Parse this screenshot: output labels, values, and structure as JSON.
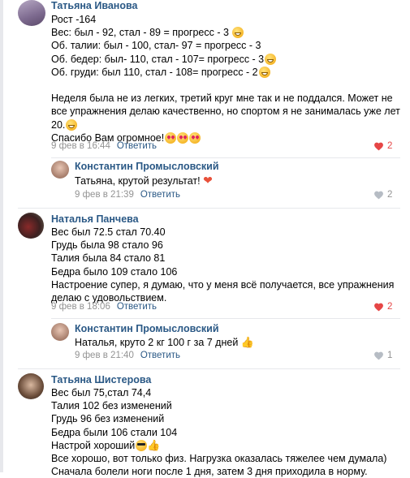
{
  "comments": [
    {
      "author": "Татьяна Иванова",
      "lines": [
        "Рост -164",
        "Вес: был - 92, стал - 89 = прогресс - 3",
        "Об. талии: был - 100, стал- 97 = прогресс - 3",
        "Об. бедер: был- 110, стал - 107= прогресс - 3",
        "Об. груди: был 110, стал - 108= прогресс - 2",
        "",
        "Неделя была не из легких, третий круг мне так и не поддался. Может не",
        "все упражнения делаю качественно, но спортом я не занималась уже лет",
        "20.",
        "Спасибо Вам огромное!"
      ],
      "time": "9 фев в 16:44",
      "reply_label": "Ответить",
      "likes": "2",
      "liked": true
    },
    {
      "author": "Константин Промысловский",
      "lines": [
        "Татьяна, крутой результат!"
      ],
      "time": "9 фев в 21:39",
      "reply_label": "Ответить",
      "likes": "2",
      "liked": false
    },
    {
      "author": "Наталья Панчева",
      "lines": [
        "Вес был 72.5 стал 70.40",
        "Грудь была 98 стало 96",
        "Талия была 84 стало 81",
        "Бедра было 109 стало 106",
        "Настроение супер, я думаю, что у меня всё получается, все упражнения",
        "делаю с удовольствием."
      ],
      "time": "9 фев в 18:06",
      "reply_label": "Ответить",
      "likes": "2",
      "liked": true
    },
    {
      "author": "Константин Промысловский",
      "lines": [
        "Наталья, круто 2 кг 100 г за 7 дней"
      ],
      "time": "9 фев в 21:40",
      "reply_label": "Ответить",
      "likes": "1",
      "liked": false
    },
    {
      "author": "Татьяна Шистерова",
      "lines": [
        "Вес был 75,стал 74,4",
        "Талия 102 без изменений",
        "Грудь 96 без изменений",
        "Бедра были 106 стали 104",
        "Настрой хороший",
        "Все хорошо, вот только физ. Нагрузка оказалась тяжелее чем думала)",
        "Сначала болели ноги после 1 дня, затем 3 дня приходила в норму."
      ]
    }
  ],
  "colors": {
    "link": "#2a5885",
    "liked": "#e64646",
    "meta": "#939393"
  },
  "icons": {
    "like": "heart-icon",
    "emoji": [
      "heart-eyes-emoji",
      "grin-emoji",
      "cool-emoji",
      "thumbs-up-emoji",
      "red-heart-emoji"
    ]
  }
}
